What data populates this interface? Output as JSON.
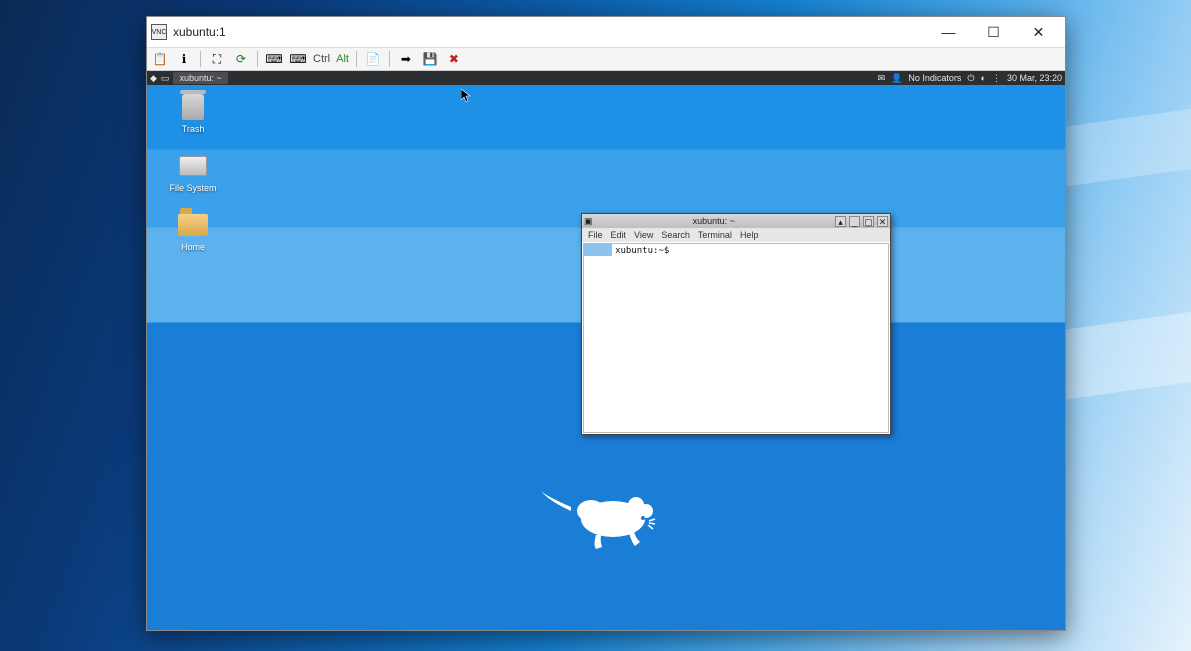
{
  "vnc": {
    "title": "xubuntu:1",
    "icon_label": "VNC",
    "buttons": {
      "min": "—",
      "max": "☐",
      "close": "✕"
    },
    "toolbar": {
      "new_conn": "📋",
      "info": "ℹ",
      "fullscreen": "⛶",
      "refresh": "⟳",
      "cad1": "⌨",
      "cad2": "⌨",
      "ctrl": "Ctrl",
      "alt": "Alt",
      "copy": "📄",
      "send": "➡",
      "save": "💾",
      "disconnect": "✖"
    }
  },
  "panel": {
    "menu_icon": "◆",
    "workspace_icon": "▭",
    "task": "xubuntu: ~",
    "right": {
      "mail_icon": "✉",
      "user_icon": "👤",
      "indicators": "No Indicators",
      "net_icon": "⏻",
      "vol_icon": "◐",
      "more_icon": "⋮",
      "clock": "30 Mar, 23:20"
    }
  },
  "desktop": {
    "icons": [
      {
        "name": "trash",
        "label": "Trash"
      },
      {
        "name": "file-system",
        "label": "File System"
      },
      {
        "name": "home",
        "label": "Home"
      }
    ]
  },
  "terminal": {
    "title": "xubuntu: ~",
    "title_icon": "▣",
    "buttons": {
      "up": "▴",
      "min": "_",
      "max": "▢",
      "close": "✕"
    },
    "menu": [
      "File",
      "Edit",
      "View",
      "Search",
      "Terminal",
      "Help"
    ],
    "prompt": "     xubuntu:~$ "
  }
}
